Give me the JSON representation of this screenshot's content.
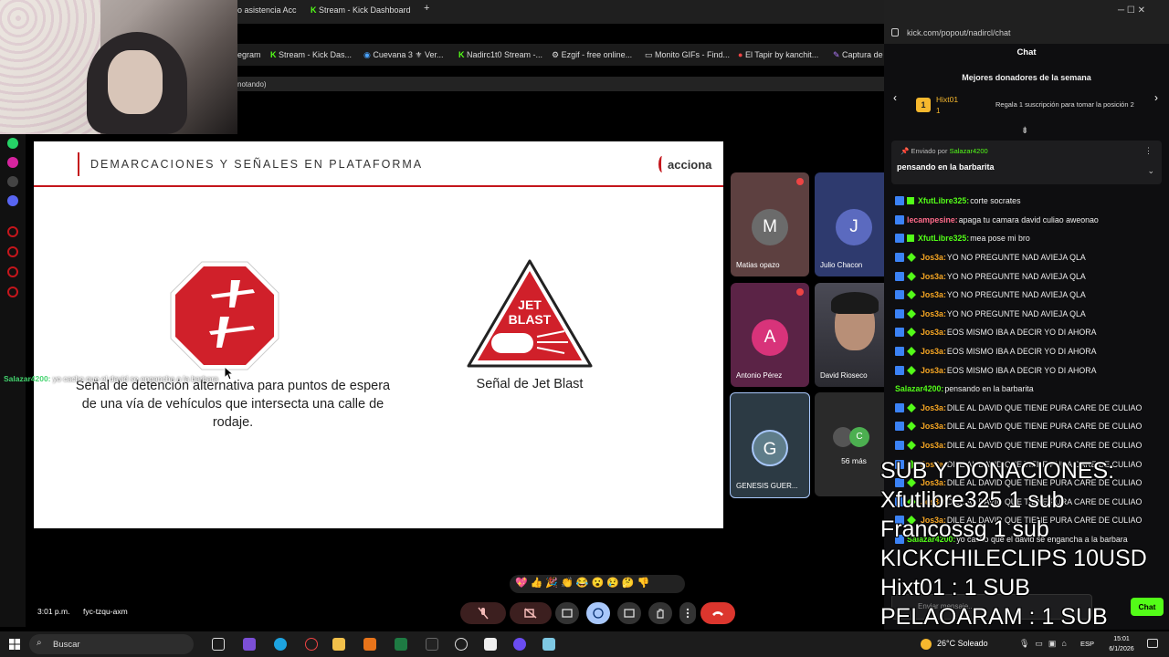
{
  "browser": {
    "tabs": [
      "o asistencia Acc",
      "Stream - Kick Dashboard"
    ],
    "bookmarks": [
      "egram",
      "Stream - Kick Das...",
      "Cuevana 3 ⚜ Ver...",
      "Nadirc1t0 Stream -...",
      "Ezgif - free online...",
      "Monito GIFs - Find...",
      "El Tapir by kanchit...",
      "Captura de"
    ],
    "meet_strip_text": "notando)"
  },
  "slide": {
    "title": "DEMARCACIONES Y SEÑALES EN PLATAFORMA",
    "logo": "acciona",
    "left_caption": "Señal de detención alternativa para puntos de espera de una vía de vehículos que intersecta una calle de rodaje.",
    "right_caption": "Señal de Jet Blast",
    "jet_blast_line1": "JET",
    "jet_blast_line2": "BLAST"
  },
  "floating_chat": {
    "user": "Salazar4200:",
    "message": "yo cacho que el david se engancha a la barbara"
  },
  "participants": [
    {
      "initial": "M",
      "name": "Matias opazo",
      "color": "#5d4040",
      "avatar": "#6b6b6b"
    },
    {
      "initial": "J",
      "name": "Julio Chacon",
      "color": "#2e3a6e",
      "avatar": "#5b6abf"
    },
    {
      "initial": "A",
      "name": "Antonio Pérez",
      "color": "#5b2346",
      "avatar": "#d8337a"
    },
    {
      "initial": "",
      "name": "David Rioseco",
      "color": "#3a3a3a",
      "avatar": ""
    },
    {
      "initial": "G",
      "name": "GENESIS GUER...",
      "color": "#2c3a44",
      "avatar": "#5f7d8a"
    }
  ],
  "more_participants": "56 más",
  "meet": {
    "time": "3:01 p.m.",
    "code": "fyc-tzqu-axm",
    "reactions": "💖👍🎉👏😂😮😢🤔👎"
  },
  "chat": {
    "url": "kick.com/popout/nadircl/chat",
    "header": "Chat",
    "top_donors_title": "Mejores donadores de la semana",
    "donor_rank": "1",
    "donor_name": "Hixt01",
    "donor_count": "1",
    "donor_cta": "Regala 1 suscripción para tomar la posición 2",
    "pinned_by_label": "Enviado por",
    "pinned_by_user": "Salazar4200",
    "pinned_message": "pensando en la barbarita",
    "messages": [
      {
        "user": "XfutLibre325:",
        "msg": "corte socrates",
        "color": "#53fc18",
        "badges": "sub"
      },
      {
        "user": "lecampesine:",
        "msg": "apaga tu camara david culiao aweonao",
        "color": "#ff6b8a",
        "badges": "blue"
      },
      {
        "user": "XfutLibre325:",
        "msg": "mea pose mi bro",
        "color": "#53fc18",
        "badges": "sub"
      },
      {
        "user": "Jos3a:",
        "msg": "YO NO PREGUNTE NAD AVIEJA QLA",
        "color": "#f6a623",
        "badges": "both"
      },
      {
        "user": "Jos3a:",
        "msg": "YO NO PREGUNTE NAD AVIEJA QLA",
        "color": "#f6a623",
        "badges": "both"
      },
      {
        "user": "Jos3a:",
        "msg": "YO NO PREGUNTE NAD AVIEJA QLA",
        "color": "#f6a623",
        "badges": "both"
      },
      {
        "user": "Jos3a:",
        "msg": "YO NO PREGUNTE NAD AVIEJA QLA",
        "color": "#f6a623",
        "badges": "both"
      },
      {
        "user": "Jos3a:",
        "msg": "EOS MISMO IBA A DECIR YO DI AHORA",
        "color": "#f6a623",
        "badges": "both"
      },
      {
        "user": "Jos3a:",
        "msg": "EOS MISMO IBA A DECIR YO DI AHORA",
        "color": "#f6a623",
        "badges": "both"
      },
      {
        "user": "Jos3a:",
        "msg": "EOS MISMO IBA A DECIR YO DI AHORA",
        "color": "#f6a623",
        "badges": "both"
      },
      {
        "user": "Salazar4200:",
        "msg": "pensando en la barbarita",
        "color": "#53fc18",
        "badges": "none"
      },
      {
        "user": "Jos3a:",
        "msg": "DILE AL DAVID QUE TIENE PURA CARE DE CULIAO",
        "color": "#f6a623",
        "badges": "both"
      },
      {
        "user": "Jos3a:",
        "msg": "DILE AL DAVID QUE TIENE PURA CARE DE CULIAO",
        "color": "#f6a623",
        "badges": "both"
      },
      {
        "user": "Jos3a:",
        "msg": "DILE AL DAVID QUE TIENE PURA CARE DE CULIAO",
        "color": "#f6a623",
        "badges": "both"
      },
      {
        "user": "Jos3a:",
        "msg": "DILE AL DAVID QUE TIENE PURA CARE DE CULIAO",
        "color": "#f6a623",
        "badges": "both"
      },
      {
        "user": "Jos3a:",
        "msg": "DILE AL DAVID QUE TIENE PURA CARE DE CULIAO",
        "color": "#f6a623",
        "badges": "both"
      },
      {
        "user": "Jos3a:",
        "msg": "DILE AL DAVID QUE TIENE PURA CARE DE CULIAO",
        "color": "#f6a623",
        "badges": "both"
      },
      {
        "user": "Jos3a:",
        "msg": "DILE AL DAVID QUE TIENE PURA CARE DE CULIAO",
        "color": "#f6a623",
        "badges": "both"
      },
      {
        "user": "Salazar4200:",
        "msg": "yo cacho que el david se engancha a la barbara",
        "color": "#53fc18",
        "badges": "blue"
      }
    ],
    "input_placeholder": "Enviar mensaje...",
    "send_label": "Chat"
  },
  "overlay": {
    "lines": [
      "SUB Y DONACIONES:",
      "Xfutlibre325 1 sub",
      "Francossg 1 sub",
      "KICKCHILECLIPS 10USD",
      "Hixt01 : 1 SUB",
      "PELAOARAM : 1 SUB"
    ]
  },
  "taskbar": {
    "search_label": "Buscar",
    "weather": "26°C  Soleado",
    "lang": "ESP",
    "time": "15:01",
    "date": "6/1/2026"
  }
}
